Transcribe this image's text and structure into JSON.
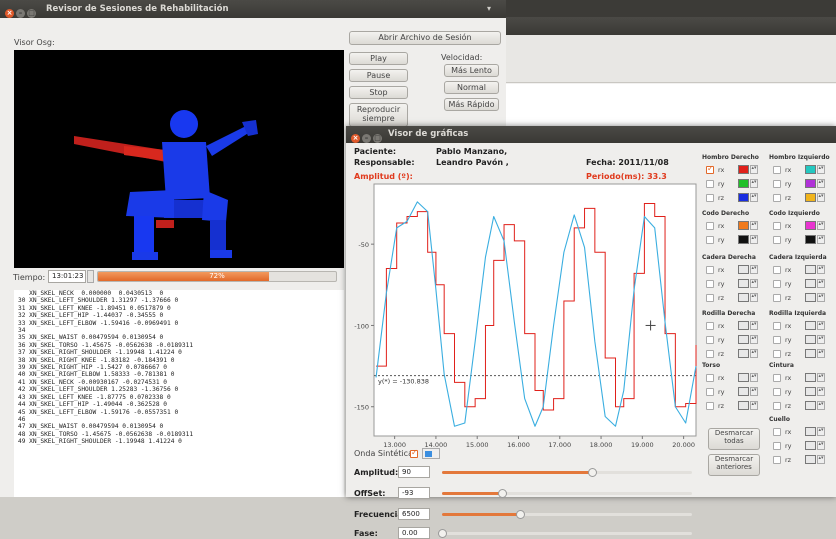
{
  "back_window": {
    "title": "Revisor de Sesiones de Rehabilitación",
    "viewer_label": "Visor Osg:",
    "open_button": "Abrir Archivo de Sesión",
    "play": "Play",
    "pause": "Pause",
    "stop": "Stop",
    "repro_line1": "Reproducir",
    "repro_line2": "siempre",
    "velocity_label": "Velocidad:",
    "slower": "Más Lento",
    "normal": "Normal",
    "faster": "Más Rápido",
    "time_label": "Tiempo:",
    "time_value": "13:01:23",
    "progress_text": "72%",
    "progress": 0.72
  },
  "log_lines": [
    "   XN_SKEL_NECK  0.000000  0.0430513  0",
    "30 XN_SKEL_LEFT_SHOULDER 1.31297 -1.37666 0",
    "31 XN_SKEL_LEFT_KNEE -1.89451 0.0517879 0",
    "32 XN_SKEL_LEFT_HIP -1.44037 -0.34555 0",
    "33 XN_SKEL_LEFT_ELBOW -1.59416 -0.0969491 0",
    "34",
    "35 XN_SKEL_WAIST 0.00479594 0.0130954 0",
    "36 XN_SKEL_TORSO -1.45675 -0.0562638 -0.0189311",
    "37 XN_SKEL_RIGHT_SHOULDER -1.19948 1.41224 0",
    "38 XN_SKEL_RIGHT_KNEE -1.83182 -0.184391 0",
    "39 XN_SKEL_RIGHT_HIP -1.5427 0.0786667 0",
    "40 XN_SKEL_RIGHT_ELBOW 1.58333 -0.781381 0",
    "41 XN_SKEL_NECK -0.00930167 -0.0274531 0",
    "42 XN_SKEL_LEFT_SHOULDER 1.25283 -1.36756 0",
    "43 XN_SKEL_LEFT_KNEE -1.87775 0.0702338 0",
    "44 XN_SKEL_LEFT_HIP -1.49044 -0.362528 0",
    "45 XN_SKEL_LEFT_ELBOW -1.59176 -0.0557351 0",
    "46",
    "47 XN_SKEL_WAIST 0.00479594 0.0130954 0",
    "48 XN_SKEL_TORSO -1.45675 -0.0562638 -0.0189311",
    "49 XN_SKEL_RIGHT_SHOULDER -1.19948 1.41224 0"
  ],
  "graph_window": {
    "title": "Visor de gráficas",
    "patient_label": "Paciente:",
    "patient_value": "Pablo Manzano,",
    "responsible_label": "Responsable:",
    "responsible_value": "Leandro Pavón ,",
    "date_label": "Fecha: 2011/11/08",
    "amplitude_label": "Amplitud (º):",
    "period_label": "Periodo(ms): 33.3",
    "cursor_readout": "y(*) = -130.838",
    "synthetic_label": "Onda Sintética",
    "amp_label": "Amplitud:",
    "amp_value": "90",
    "amp_slider": 0.6,
    "offset_label": "OffSet:",
    "offset_value": "-93",
    "offset_slider": 0.24,
    "freq_label": "Frecuencia:",
    "freq_value": "6500",
    "freq_slider": 0.31,
    "phase_label": "Fase:",
    "phase_value": "0.00",
    "phase_slider": 0.0,
    "untick_all": "Desmarcar todas",
    "untick_prev": "Desmarcar anteriores",
    "groups": [
      {
        "title": "Hombro Derecho",
        "rows": [
          {
            "axis": "rx",
            "color": "#e0201a",
            "checked": true
          },
          {
            "axis": "ry",
            "color": "#22c02a",
            "checked": false
          },
          {
            "axis": "rz",
            "color": "#1a2ee0",
            "checked": false
          }
        ]
      },
      {
        "title": "Hombro Izquierdo",
        "rows": [
          {
            "axis": "rx",
            "color": "#24c8c0",
            "checked": false
          },
          {
            "axis": "ry",
            "color": "#b032d8",
            "checked": false
          },
          {
            "axis": "rz",
            "color": "#f0b41c",
            "checked": false
          }
        ]
      },
      {
        "title": "Codo Derecho",
        "rows": [
          {
            "axis": "rx",
            "color": "#f07a1c",
            "checked": false
          },
          {
            "axis": "ry",
            "color": "#111111",
            "checked": false
          }
        ]
      },
      {
        "title": "Codo Izquierdo",
        "rows": [
          {
            "axis": "rx",
            "color": "#e834d0",
            "checked": false
          },
          {
            "axis": "ry",
            "color": "#111111",
            "checked": false
          }
        ]
      },
      {
        "title": "Cadera Derecha",
        "rows": [
          {
            "axis": "rx",
            "color": "#e8e8e8",
            "checked": false
          },
          {
            "axis": "ry",
            "color": "#e8e8e8",
            "checked": false
          },
          {
            "axis": "rz",
            "color": "#e8e8e8",
            "checked": false
          }
        ]
      },
      {
        "title": "Cadera Izquierda",
        "rows": [
          {
            "axis": "rx",
            "color": "#e8e8e8",
            "checked": false
          },
          {
            "axis": "ry",
            "color": "#e8e8e8",
            "checked": false
          },
          {
            "axis": "rz",
            "color": "#e8e8e8",
            "checked": false
          }
        ]
      },
      {
        "title": "Rodilla Derecha",
        "rows": [
          {
            "axis": "rx",
            "color": "#e8e8e8",
            "checked": false
          },
          {
            "axis": "ry",
            "color": "#e8e8e8",
            "checked": false
          },
          {
            "axis": "rz",
            "color": "#e8e8e8",
            "checked": false
          }
        ]
      },
      {
        "title": "Rodilla Izquierda",
        "rows": [
          {
            "axis": "rx",
            "color": "#e8e8e8",
            "checked": false
          },
          {
            "axis": "ry",
            "color": "#e8e8e8",
            "checked": false
          },
          {
            "axis": "rz",
            "color": "#e8e8e8",
            "checked": false
          }
        ]
      },
      {
        "title": "Torso",
        "rows": [
          {
            "axis": "rx",
            "color": "#e8e8e8",
            "checked": false
          },
          {
            "axis": "ry",
            "color": "#e8e8e8",
            "checked": false
          },
          {
            "axis": "rz",
            "color": "#e8e8e8",
            "checked": false
          }
        ]
      },
      {
        "title": "Cintura",
        "rows": [
          {
            "axis": "rx",
            "color": "#e8e8e8",
            "checked": false
          },
          {
            "axis": "ry",
            "color": "#e8e8e8",
            "checked": false
          },
          {
            "axis": "rz",
            "color": "#e8e8e8",
            "checked": false
          }
        ]
      },
      {
        "title": "Cuello",
        "rows": [
          {
            "axis": "rx",
            "color": "#e8e8e8",
            "checked": false
          },
          {
            "axis": "ry",
            "color": "#e8e8e8",
            "checked": false
          },
          {
            "axis": "rz",
            "color": "#e8e8e8",
            "checked": false
          }
        ]
      }
    ]
  },
  "chart_data": {
    "type": "line",
    "xlim": [
      12.5,
      20.3
    ],
    "ylim": [
      -168,
      -13
    ],
    "x_ticks": [
      13,
      14,
      15,
      16,
      17,
      18,
      19,
      20
    ],
    "x_tick_labels": [
      "13.000",
      "14.000",
      "15.000",
      "16.000",
      "17.000",
      "18.000",
      "19.000",
      "20.000"
    ],
    "y_ticks": [
      -50,
      -100,
      -150
    ],
    "y_tick_labels": [
      "-50",
      "-100",
      "-150"
    ],
    "cursor_y": -130.838,
    "series": [
      {
        "color": "#e0201a",
        "kind": "measured",
        "x": [
          12.55,
          12.8,
          13.05,
          13.3,
          13.55,
          13.8,
          14.0,
          14.2,
          14.45,
          14.7,
          14.95,
          15.2,
          15.4,
          15.65,
          15.9,
          16.15,
          16.4,
          16.6,
          16.85,
          17.1,
          17.35,
          17.6,
          17.85,
          18.1,
          18.35,
          18.55,
          18.8,
          19.05,
          19.3,
          19.55,
          19.8,
          20.05,
          20.3
        ],
        "y": [
          -125,
          -65,
          -37,
          -33,
          -30,
          -55,
          -75,
          -105,
          -135,
          -150,
          -145,
          -100,
          -60,
          -38,
          -48,
          -105,
          -140,
          -152,
          -145,
          -85,
          -40,
          -28,
          -55,
          -120,
          -150,
          -145,
          -68,
          -25,
          -33,
          -105,
          -150,
          -148,
          -112
        ]
      },
      {
        "color": "#3aaee0",
        "kind": "synthetic",
        "x": [
          12.55,
          12.8,
          13.05,
          13.3,
          13.55,
          13.8,
          14.0,
          14.2,
          14.45,
          14.7,
          14.95,
          15.2,
          15.4,
          15.65,
          15.9,
          16.15,
          16.4,
          16.6,
          16.85,
          17.1,
          17.35,
          17.6,
          17.85,
          18.1,
          18.35,
          18.55,
          18.8,
          19.05,
          19.3,
          19.55,
          19.8,
          20.05,
          20.3
        ],
        "y": [
          -132,
          -80,
          -40,
          -36,
          -24,
          -30,
          -78,
          -130,
          -162,
          -160,
          -110,
          -58,
          -33,
          -48,
          -98,
          -145,
          -162,
          -150,
          -100,
          -55,
          -32,
          -52,
          -110,
          -156,
          -162,
          -140,
          -78,
          -33,
          -40,
          -98,
          -150,
          -160,
          -125
        ]
      }
    ]
  }
}
